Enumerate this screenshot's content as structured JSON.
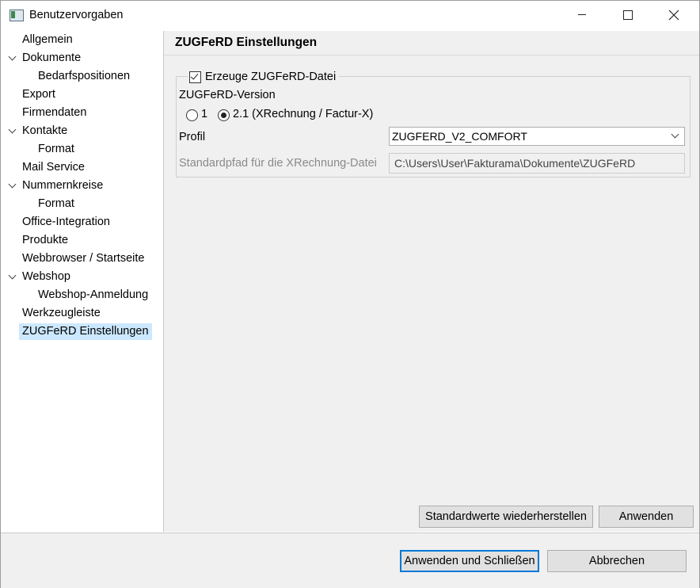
{
  "window": {
    "title": "Benutzervorgaben",
    "minimize_icon": "minimize-icon",
    "maximize_icon": "maximize-icon",
    "close_icon": "close-icon"
  },
  "sidebar": {
    "items": [
      {
        "label": "Allgemein",
        "level": 0,
        "expanded": null
      },
      {
        "label": "Dokumente",
        "level": 0,
        "expanded": true
      },
      {
        "label": "Bedarfspositionen",
        "level": 1,
        "expanded": null
      },
      {
        "label": "Export",
        "level": 0,
        "expanded": null
      },
      {
        "label": "Firmendaten",
        "level": 0,
        "expanded": null
      },
      {
        "label": "Kontakte",
        "level": 0,
        "expanded": true
      },
      {
        "label": "Format",
        "level": 1,
        "expanded": null
      },
      {
        "label": "Mail Service",
        "level": 0,
        "expanded": null
      },
      {
        "label": "Nummernkreise",
        "level": 0,
        "expanded": true
      },
      {
        "label": "Format",
        "level": 1,
        "expanded": null
      },
      {
        "label": "Office-Integration",
        "level": 0,
        "expanded": null
      },
      {
        "label": "Produkte",
        "level": 0,
        "expanded": null
      },
      {
        "label": "Webbrowser / Startseite",
        "level": 0,
        "expanded": null
      },
      {
        "label": "Webshop",
        "level": 0,
        "expanded": true
      },
      {
        "label": "Webshop-Anmeldung",
        "level": 1,
        "expanded": null
      },
      {
        "label": "Werkzeugleiste",
        "level": 0,
        "expanded": null
      },
      {
        "label": "ZUGFeRD Einstellungen",
        "level": 0,
        "expanded": null,
        "selected": true
      }
    ]
  },
  "main": {
    "title": "ZUGFeRD Einstellungen",
    "create_checkbox": {
      "label": "Erzeuge ZUGFeRD-Datei",
      "checked": true
    },
    "version_label": "ZUGFeRD-Version",
    "version_options": [
      {
        "label": "1",
        "checked": false
      },
      {
        "label": "2.1 (XRechnung / Factur-X)",
        "checked": true
      }
    ],
    "profile_label": "Profil",
    "profile_value": "ZUGFERD_V2_COMFORT",
    "path_label": "Standardpfad für die XRechnung-Datei",
    "path_value": "C:\\Users\\User\\Fakturama\\Dokumente\\ZUGFeRD",
    "restore_defaults_label": "Standardwerte wiederherstellen",
    "apply_label": "Anwenden"
  },
  "footer": {
    "apply_close_label": "Anwenden und Schließen",
    "cancel_label": "Abbrechen"
  },
  "colors": {
    "selection": "#cce8ff",
    "accent": "#0078d7",
    "panel_background": "#f0f0f0"
  }
}
